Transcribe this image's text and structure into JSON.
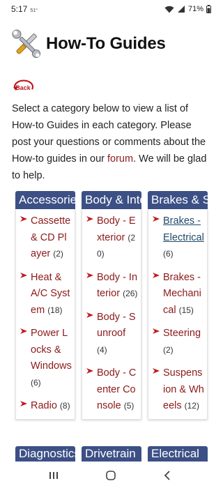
{
  "status": {
    "time": "5:17",
    "temp": "51°",
    "battery": "71%"
  },
  "header": {
    "title": "How-To Guides",
    "icon": "tools-icon"
  },
  "back": {
    "label": "Back"
  },
  "intro": {
    "text_before": "Select a category below to view a list of How-to Guides in each category.  Please post your questions or comments about the How-to guides in our ",
    "link": "forum",
    "text_after": ". We will be glad to help."
  },
  "colors": {
    "accent": "#3c5086",
    "link": "#8b1a1a",
    "visited": "#1f4a6a"
  },
  "columns": [
    {
      "header": "Accessories",
      "items": [
        {
          "label": "Cassette & CD Player",
          "count": "(2)"
        },
        {
          "label": "Heat & A/C System",
          "count": "(18)"
        },
        {
          "label": "Power Locks & Windows",
          "count": "(6)"
        },
        {
          "label": "Radio",
          "count": "(8)"
        }
      ]
    },
    {
      "header": "Body & Interior",
      "items": [
        {
          "label": "Body - Exterior",
          "count": "(20)"
        },
        {
          "label": "Body - Interior",
          "count": "(26)"
        },
        {
          "label": "Body - Sunroof",
          "count": "(4)"
        },
        {
          "label": "Body - Center Console",
          "count": "(5)"
        }
      ]
    },
    {
      "header": "Brakes & Suspension",
      "items": [
        {
          "label": "Brakes - Electrical",
          "count": "(6)",
          "visited": true
        },
        {
          "label": "Brakes - Mechanical",
          "count": "(15)"
        },
        {
          "label": "Steering",
          "count": "(2)"
        },
        {
          "label": "Suspension & Wheels",
          "count": "(12)"
        }
      ]
    }
  ],
  "bottom_columns": [
    {
      "header": "Diagnostics"
    },
    {
      "header": "Drivetrain"
    },
    {
      "header": "Electrical"
    }
  ]
}
